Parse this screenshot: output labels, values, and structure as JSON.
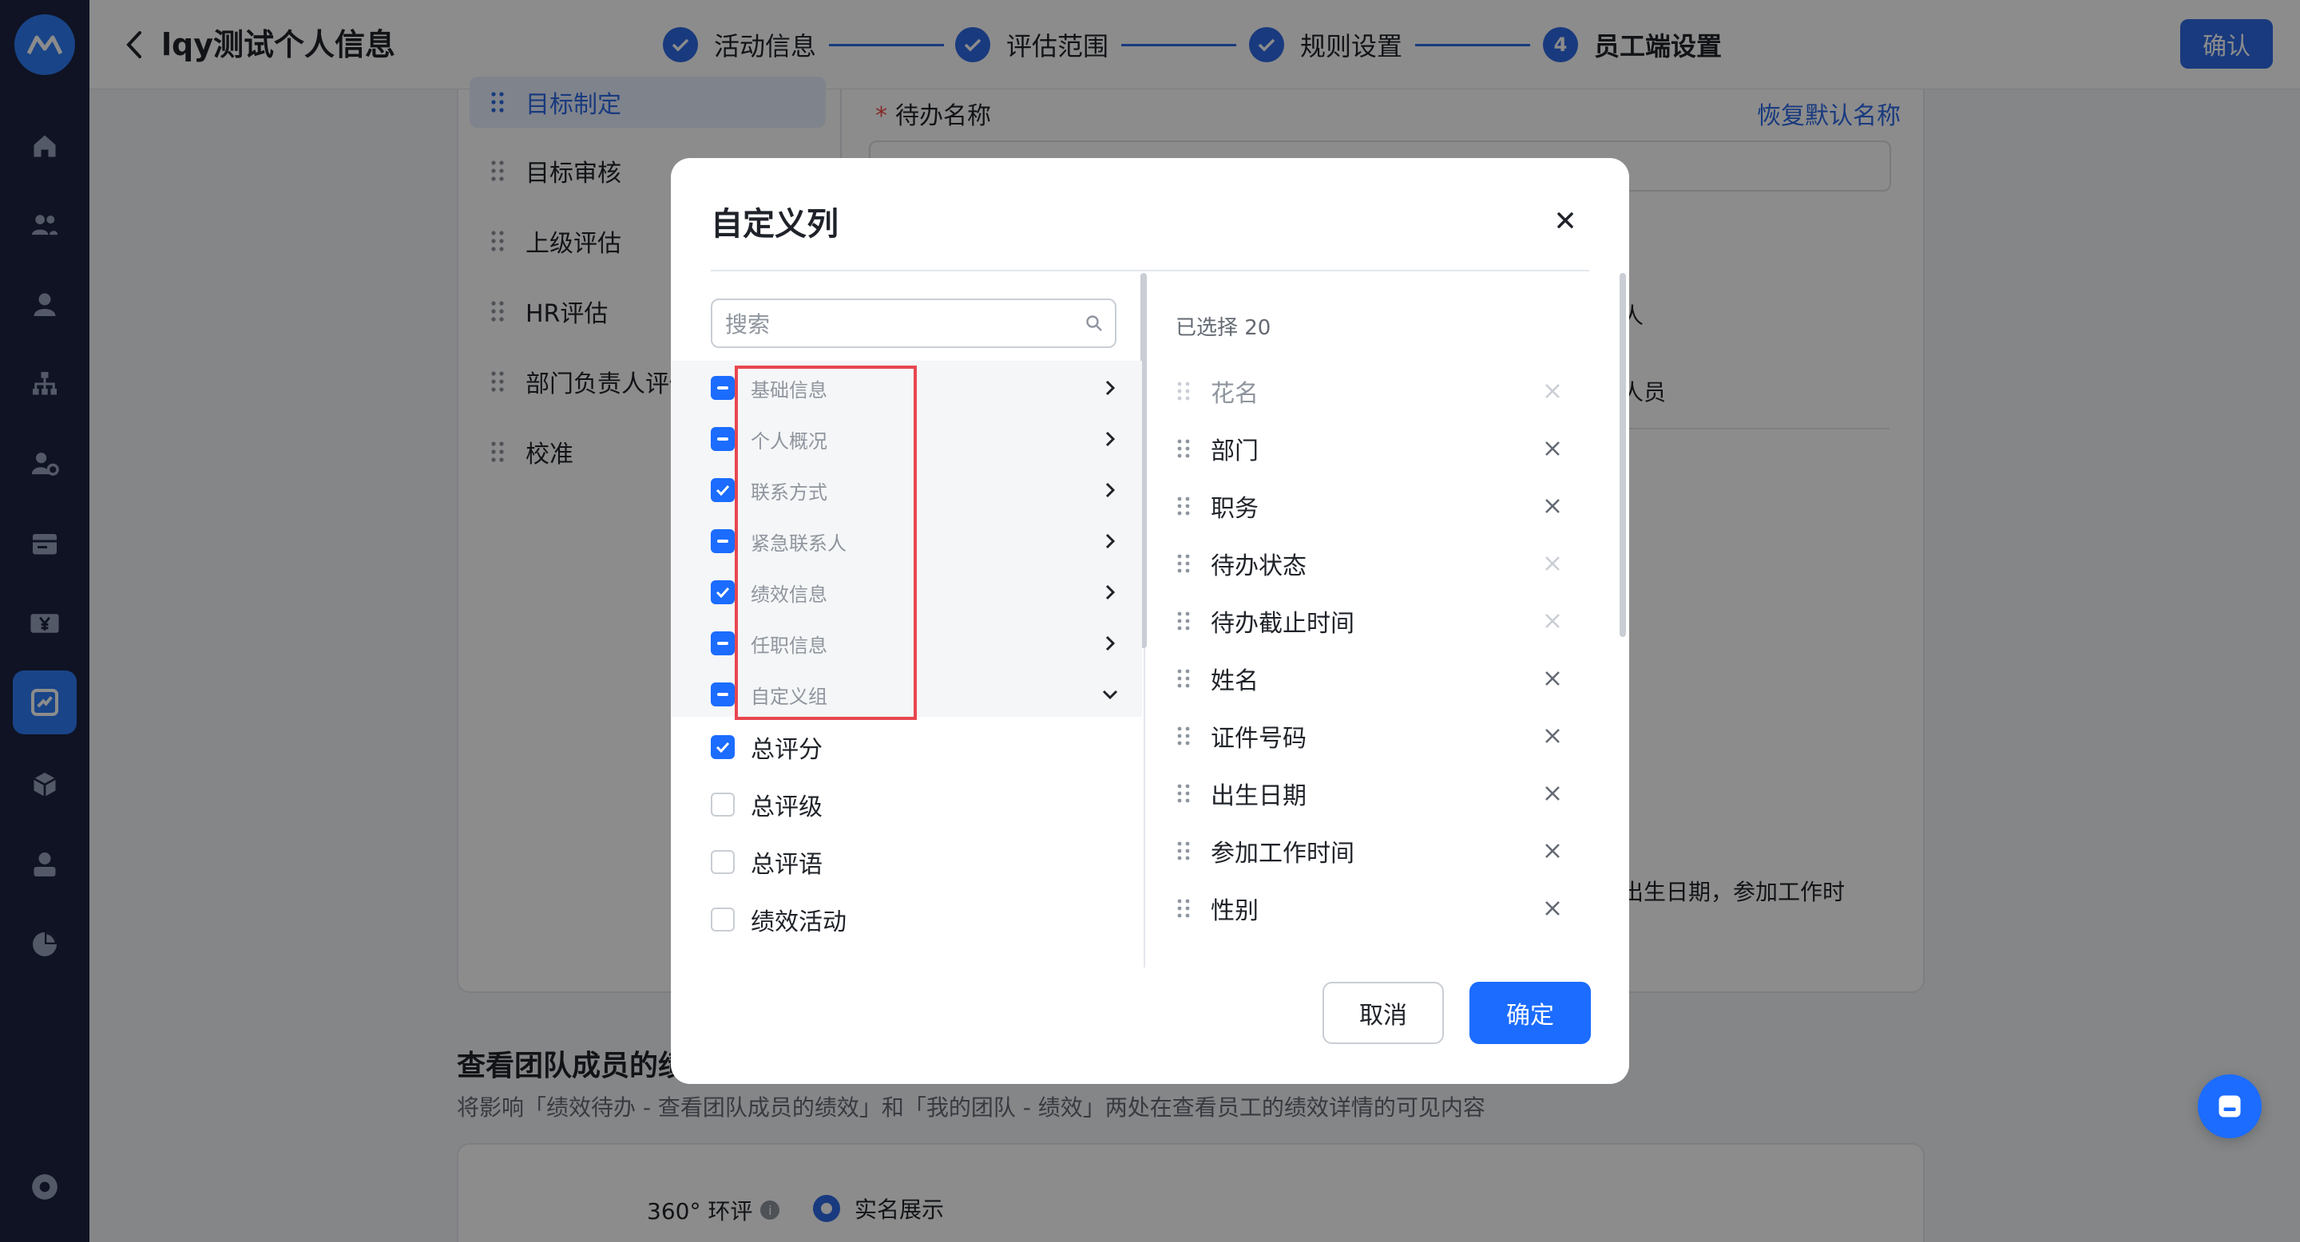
{
  "header": {
    "title": "lqy测试个人信息",
    "confirm_label": "确认",
    "steps": [
      {
        "label": "活动信息",
        "status": "done"
      },
      {
        "label": "评估范围",
        "status": "done"
      },
      {
        "label": "规则设置",
        "status": "done"
      },
      {
        "label": "员工端设置",
        "status": "current",
        "number": "4"
      }
    ]
  },
  "sidebar": {
    "icons": [
      "home-icon",
      "team-icon",
      "person-icon",
      "org-chart-icon",
      "user-settings-icon",
      "calendar-icon",
      "salary-icon",
      "performance-icon",
      "box-icon",
      "profile-icon",
      "pie-chart-icon",
      "settings-icon"
    ]
  },
  "background": {
    "tree_items": [
      "目标制定",
      "目标审核",
      "上级评估",
      "HR评估",
      "部门负责人评估",
      "校准"
    ],
    "field_label": "待办名称",
    "restore_link": "恢复默认名称",
    "fragment_ren": "人",
    "fragment_renyuan": "人员",
    "fragment_text": "出生日期，参加工作时",
    "section_title": "查看团队成员的绩",
    "section_desc": "将影响「绩效待办 - 查看团队成员的绩效」和「我的团队 - 绩效」两处在查看员工的绩效详情的可见内容",
    "row_label": "360° 环评",
    "radio_label": "实名展示"
  },
  "modal": {
    "title": "自定义列",
    "search_placeholder": "搜索",
    "groups": [
      {
        "label": "基础信息",
        "state": "partial",
        "expand": "right"
      },
      {
        "label": "个人概况",
        "state": "partial",
        "expand": "right"
      },
      {
        "label": "联系方式",
        "state": "checked",
        "expand": "right"
      },
      {
        "label": "紧急联系人",
        "state": "partial",
        "expand": "right"
      },
      {
        "label": "绩效信息",
        "state": "checked",
        "expand": "right"
      },
      {
        "label": "任职信息",
        "state": "partial",
        "expand": "right"
      },
      {
        "label": "自定义组",
        "state": "partial",
        "expand": "down"
      }
    ],
    "options": [
      {
        "label": "总评分",
        "state": "checked"
      },
      {
        "label": "总评级",
        "state": "unchecked"
      },
      {
        "label": "总评语",
        "state": "unchecked"
      },
      {
        "label": "绩效活动",
        "state": "unchecked"
      }
    ],
    "selected_count": "已选择 20",
    "selected": [
      {
        "label": "花名",
        "disabled": true
      },
      {
        "label": "部门",
        "disabled": false
      },
      {
        "label": "职务",
        "disabled": false
      },
      {
        "label": "待办状态",
        "disabled": true
      },
      {
        "label": "待办截止时间",
        "disabled": true
      },
      {
        "label": "姓名",
        "disabled": false
      },
      {
        "label": "证件号码",
        "disabled": false
      },
      {
        "label": "出生日期",
        "disabled": false
      },
      {
        "label": "参加工作时间",
        "disabled": false
      },
      {
        "label": "性别",
        "disabled": false
      }
    ],
    "cancel_label": "取消",
    "ok_label": "确定"
  },
  "colors": {
    "primary": "#1b6cff",
    "sidebar": "#1d2440",
    "highlight_box": "#e8474f"
  }
}
